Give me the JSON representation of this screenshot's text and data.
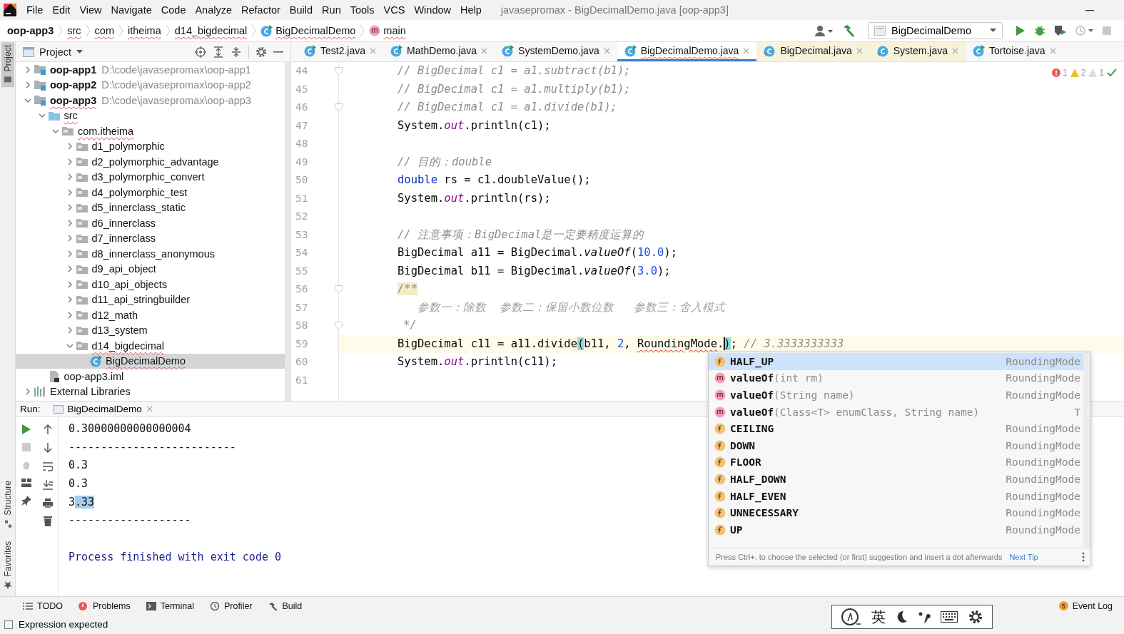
{
  "window": {
    "title": "javasepromax - BigDecimalDemo.java [oop-app3]"
  },
  "menu": [
    "File",
    "Edit",
    "View",
    "Navigate",
    "Code",
    "Analyze",
    "Refactor",
    "Build",
    "Run",
    "Tools",
    "VCS",
    "Window",
    "Help"
  ],
  "breadcrumbs": [
    {
      "label": "oop-app3",
      "kind": "module",
      "typo": false
    },
    {
      "label": "src",
      "kind": "folder",
      "typo": true
    },
    {
      "label": "com",
      "kind": "folder",
      "typo": true
    },
    {
      "label": "itheima",
      "kind": "folder",
      "typo": true
    },
    {
      "label": "d14_bigdecimal",
      "kind": "folder",
      "typo": true
    },
    {
      "label": "BigDecimalDemo",
      "kind": "class",
      "typo": true
    },
    {
      "label": "main",
      "kind": "method",
      "typo": true
    }
  ],
  "run_configuration": "BigDecimalDemo",
  "left_stripe": {
    "top": [
      {
        "label": "Project",
        "selected": true
      }
    ],
    "bottom": [
      {
        "label": "Structure",
        "selected": false
      },
      {
        "label": "Favorites",
        "selected": false
      }
    ]
  },
  "project": {
    "title": "Project",
    "tree": [
      {
        "label": "oop-app1",
        "kind": "module",
        "path": "D:\\code\\javasepromax\\oop-app1",
        "expanded": false,
        "selected": false,
        "typo": false
      },
      {
        "label": "oop-app2",
        "kind": "module",
        "path": "D:\\code\\javasepromax\\oop-app2",
        "expanded": false,
        "selected": false,
        "typo": false
      },
      {
        "label": "oop-app3",
        "kind": "module",
        "path": "D:\\code\\javasepromax\\oop-app3",
        "expanded": true,
        "selected": false,
        "typo": true,
        "children": [
          {
            "label": "src",
            "kind": "source",
            "expanded": true,
            "selected": false,
            "typo": true,
            "children": [
              {
                "label": "com.itheima",
                "kind": "package",
                "expanded": true,
                "selected": false,
                "typo": true,
                "children": [
                  {
                    "label": "d1_polymorphic",
                    "kind": "package",
                    "expanded": false,
                    "selected": false,
                    "typo": false
                  },
                  {
                    "label": "d2_polymorphic_advantage",
                    "kind": "package",
                    "expanded": false,
                    "selected": false,
                    "typo": false
                  },
                  {
                    "label": "d3_polymorphic_convert",
                    "kind": "package",
                    "expanded": false,
                    "selected": false,
                    "typo": false
                  },
                  {
                    "label": "d4_polymorphic_test",
                    "kind": "package",
                    "expanded": false,
                    "selected": false,
                    "typo": false
                  },
                  {
                    "label": "d5_innerclass_static",
                    "kind": "package",
                    "expanded": false,
                    "selected": false,
                    "typo": false
                  },
                  {
                    "label": "d6_innerclass",
                    "kind": "package",
                    "expanded": false,
                    "selected": false,
                    "typo": false
                  },
                  {
                    "label": "d7_innerclass",
                    "kind": "package",
                    "expanded": false,
                    "selected": false,
                    "typo": false
                  },
                  {
                    "label": "d8_innerclass_anonymous",
                    "kind": "package",
                    "expanded": false,
                    "selected": false,
                    "typo": false
                  },
                  {
                    "label": "d9_api_object",
                    "kind": "package",
                    "expanded": false,
                    "selected": false,
                    "typo": false
                  },
                  {
                    "label": "d10_api_objects",
                    "kind": "package",
                    "expanded": false,
                    "selected": false,
                    "typo": false
                  },
                  {
                    "label": "d11_api_stringbuilder",
                    "kind": "package",
                    "expanded": false,
                    "selected": false,
                    "typo": false
                  },
                  {
                    "label": "d12_math",
                    "kind": "package",
                    "expanded": false,
                    "selected": false,
                    "typo": false
                  },
                  {
                    "label": "d13_system",
                    "kind": "package",
                    "expanded": false,
                    "selected": false,
                    "typo": false
                  },
                  {
                    "label": "d14_bigdecimal",
                    "kind": "package",
                    "expanded": true,
                    "selected": false,
                    "typo": true,
                    "children": [
                      {
                        "label": "BigDecimalDemo",
                        "kind": "class",
                        "selected": true,
                        "typo": true
                      }
                    ]
                  }
                ]
              }
            ]
          },
          {
            "label": "oop-app3.iml",
            "kind": "iml",
            "selected": false,
            "typo": false
          }
        ]
      },
      {
        "label": "External Libraries",
        "kind": "libraries",
        "expanded": false,
        "selected": false,
        "typo": false
      }
    ]
  },
  "tabs": [
    {
      "label": "Test2.java",
      "kind": "source",
      "selected": false,
      "typo": false
    },
    {
      "label": "MathDemo.java",
      "kind": "source",
      "selected": false,
      "typo": false
    },
    {
      "label": "SystemDemo.java",
      "kind": "source",
      "selected": false,
      "typo": false
    },
    {
      "label": "BigDecimalDemo.java",
      "kind": "source",
      "selected": true,
      "typo": true
    },
    {
      "label": "BigDecimal.java",
      "kind": "library",
      "selected": false,
      "typo": false
    },
    {
      "label": "System.java",
      "kind": "library",
      "selected": false,
      "typo": false
    },
    {
      "label": "Tortoise.java",
      "kind": "source",
      "selected": false,
      "typo": false
    }
  ],
  "inspections": [
    {
      "kind": "error",
      "count": "1"
    },
    {
      "kind": "warning",
      "count": "2"
    },
    {
      "kind": "weak",
      "count": "1"
    }
  ],
  "editor": {
    "lines": [
      {
        "number": "44",
        "current": false,
        "tokens": [
          {
            "text": "// BigDecimal c1 = a1.subtract(b1);",
            "kind": "comment"
          }
        ]
      },
      {
        "number": "45",
        "current": false,
        "tokens": [
          {
            "text": "// BigDecimal c1 = a1.multiply(b1);",
            "kind": "comment"
          }
        ]
      },
      {
        "number": "46",
        "current": false,
        "tokens": [
          {
            "text": "// BigDecimal c1 = a1.divide(b1);",
            "kind": "comment"
          }
        ]
      },
      {
        "number": "47",
        "current": false,
        "tokens": [
          {
            "text": "System.",
            "kind": "plain"
          },
          {
            "text": "out",
            "kind": "field"
          },
          {
            "text": ".println(c1);",
            "kind": "plain"
          }
        ]
      },
      {
        "number": "48",
        "current": false
      },
      {
        "number": "49",
        "current": false,
        "tokens": [
          {
            "text": "// 目的：double",
            "kind": "comment"
          }
        ]
      },
      {
        "number": "50",
        "current": false,
        "tokens": [
          {
            "text": "double",
            "kind": "keyword"
          },
          {
            "text": " rs = c1.doubleValue();",
            "kind": "plain"
          }
        ]
      },
      {
        "number": "51",
        "current": false,
        "tokens": [
          {
            "text": "System.",
            "kind": "plain"
          },
          {
            "text": "out",
            "kind": "field"
          },
          {
            "text": ".println(rs);",
            "kind": "plain"
          }
        ]
      },
      {
        "number": "52",
        "current": false
      },
      {
        "number": "53",
        "current": false,
        "tokens": [
          {
            "text": "// 注意事项：BigDecimal是一定要精度运算的",
            "kind": "comment"
          }
        ]
      },
      {
        "number": "54",
        "current": false,
        "tokens": [
          {
            "text": "BigDecimal a11 = BigDecimal.",
            "kind": "plain"
          },
          {
            "text": "valueOf",
            "kind": "static"
          },
          {
            "text": "(",
            "kind": "plain"
          },
          {
            "text": "10.0",
            "kind": "number"
          },
          {
            "text": ");",
            "kind": "plain"
          }
        ]
      },
      {
        "number": "55",
        "current": false,
        "tokens": [
          {
            "text": "BigDecimal b11 = BigDecimal.",
            "kind": "plain"
          },
          {
            "text": "valueOf",
            "kind": "static"
          },
          {
            "text": "(",
            "kind": "plain"
          },
          {
            "text": "3.0",
            "kind": "number"
          },
          {
            "text": ");",
            "kind": "plain"
          }
        ]
      },
      {
        "number": "56",
        "current": false,
        "tokens": [
          {
            "text": "/**",
            "kind": "doc-start"
          }
        ]
      },
      {
        "number": "57",
        "current": false,
        "tokens": [
          {
            "text": "参数一：除数  参数二：保留小数位数   参数三：舍入模式",
            "kind": "doc-body"
          }
        ]
      },
      {
        "number": "58",
        "current": false,
        "tokens": [
          {
            "text": "*/",
            "kind": "doc-end"
          }
        ]
      },
      {
        "number": "59",
        "current": true,
        "tokens": [
          {
            "text": "BigDecimal c11 = a11.divide",
            "kind": "plain"
          },
          {
            "text": "(",
            "kind": "brace"
          },
          {
            "text": "b11, ",
            "kind": "plain"
          },
          {
            "text": "2",
            "kind": "number"
          },
          {
            "text": ", ",
            "kind": "plain"
          },
          {
            "text": "RoundingMode",
            "kind": "error"
          },
          {
            "text": ".",
            "kind": "plain"
          },
          {
            "text": ")",
            "kind": "brace-caret"
          },
          {
            "text": ";",
            "kind": "plain"
          },
          {
            "text": " // 3.3333333333",
            "kind": "comment"
          }
        ]
      },
      {
        "number": "60",
        "current": false,
        "tokens": [
          {
            "text": "System.",
            "kind": "plain"
          },
          {
            "text": "out",
            "kind": "field"
          },
          {
            "text": ".println(c11);",
            "kind": "plain"
          }
        ]
      },
      {
        "number": "61",
        "current": false
      }
    ]
  },
  "completion": {
    "items": [
      {
        "kind": "field",
        "name": "HALF_UP",
        "type": "RoundingMode",
        "selected": true
      },
      {
        "kind": "method",
        "name": "valueOf",
        "params": "(int rm)",
        "type": "RoundingMode",
        "selected": false
      },
      {
        "kind": "method",
        "name": "valueOf",
        "params": "(String name)",
        "type": "RoundingMode",
        "selected": false
      },
      {
        "kind": "method",
        "name": "valueOf",
        "params": "(Class<T> enumClass, String name)",
        "type": "T",
        "selected": false
      },
      {
        "kind": "field",
        "name": "CEILING",
        "type": "RoundingMode",
        "selected": false
      },
      {
        "kind": "field",
        "name": "DOWN",
        "type": "RoundingMode",
        "selected": false
      },
      {
        "kind": "field",
        "name": "FLOOR",
        "type": "RoundingMode",
        "selected": false
      },
      {
        "kind": "field",
        "name": "HALF_DOWN",
        "type": "RoundingMode",
        "selected": false
      },
      {
        "kind": "field",
        "name": "HALF_EVEN",
        "type": "RoundingMode",
        "selected": false
      },
      {
        "kind": "field",
        "name": "UNNECESSARY",
        "type": "RoundingMode",
        "selected": false
      },
      {
        "kind": "field",
        "name": "UP",
        "type": "RoundingMode",
        "selected": false
      }
    ],
    "tip": "Press Ctrl+. to choose the selected (or first) suggestion and insert a dot afterwards",
    "next_tip": "Next Tip"
  },
  "run": {
    "title": "Run:",
    "tab": "BigDecimalDemo",
    "output": [
      {
        "kind": "stdout",
        "segments": [
          {
            "text": "0.30000000000000004",
            "selected": false
          }
        ]
      },
      {
        "kind": "stdout",
        "segments": [
          {
            "text": "--------------------------",
            "selected": false
          }
        ]
      },
      {
        "kind": "stdout",
        "segments": [
          {
            "text": "0.3",
            "selected": false
          }
        ]
      },
      {
        "kind": "stdout",
        "segments": [
          {
            "text": "0.3",
            "selected": false
          }
        ]
      },
      {
        "kind": "stdout",
        "segments": [
          {
            "text": "3",
            "selected": false
          },
          {
            "text": ".33",
            "selected": true
          }
        ]
      },
      {
        "kind": "stdout",
        "segments": [
          {
            "text": "-------------------",
            "selected": false
          }
        ]
      },
      {
        "kind": "exit",
        "segments": [
          {
            "text": "Process finished with exit code 0",
            "selected": false
          }
        ]
      }
    ]
  },
  "tool_windows": [
    {
      "label": "TODO",
      "kind": "todo"
    },
    {
      "label": "Problems",
      "kind": "problems"
    },
    {
      "label": "Terminal",
      "kind": "terminal"
    },
    {
      "label": "Profiler",
      "kind": "profiler"
    },
    {
      "label": "Build",
      "kind": "build"
    }
  ],
  "event_log": {
    "label": "Event Log",
    "badge": "5"
  },
  "ime": {
    "mode": "英"
  },
  "status_bar": {
    "message": "Expression expected"
  }
}
